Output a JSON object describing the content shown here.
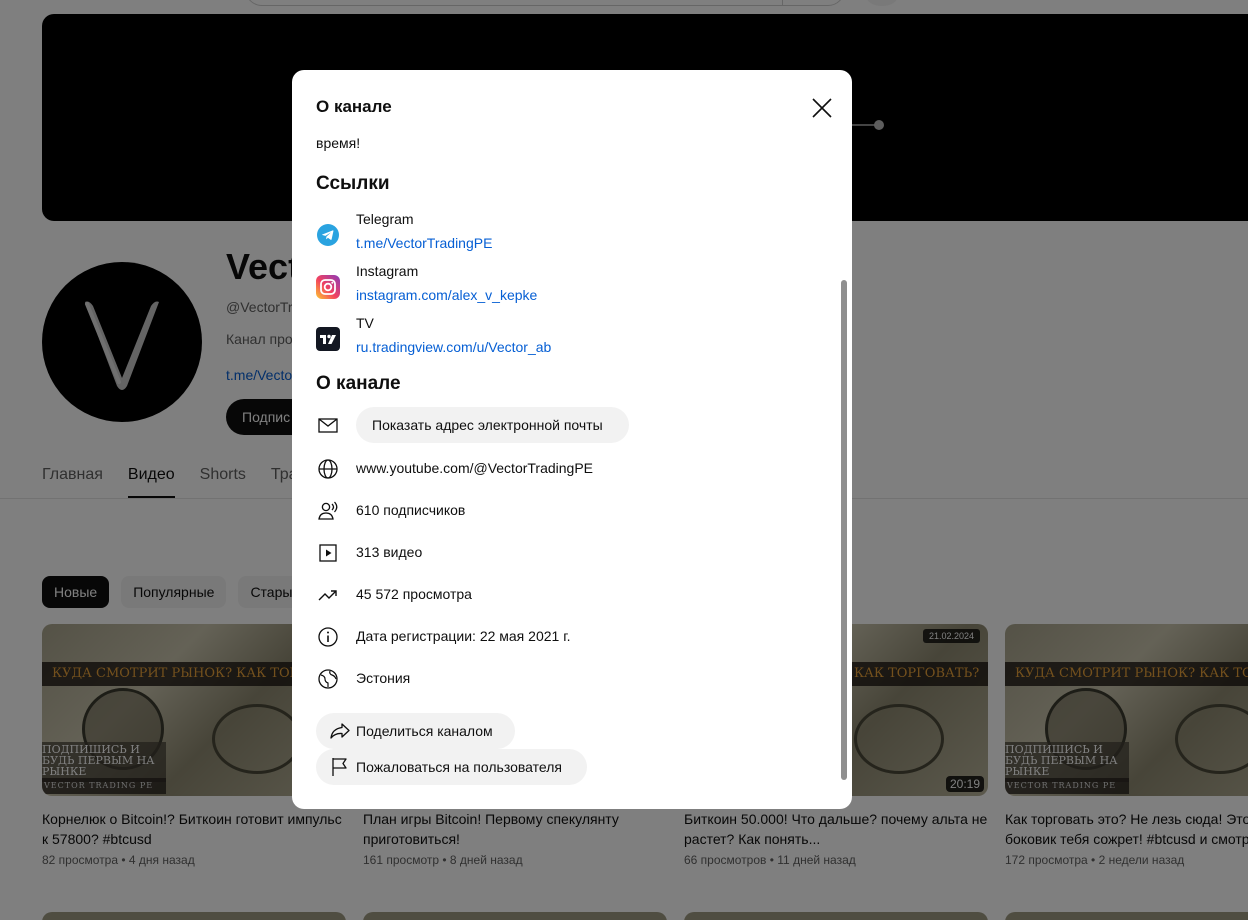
{
  "channel": {
    "name": "Vect",
    "handle": "@VectorTr",
    "description": "Канал про",
    "link": "t.me/Vecto",
    "subscribe_label": "Подпис"
  },
  "tabs": [
    {
      "label": "Главная",
      "active": false
    },
    {
      "label": "Видео",
      "active": true
    },
    {
      "label": "Shorts",
      "active": false
    },
    {
      "label": "Тра",
      "active": false
    }
  ],
  "chips": [
    {
      "label": "Новые",
      "active": true
    },
    {
      "label": "Популярные",
      "active": false
    },
    {
      "label": "Стары",
      "active": false
    }
  ],
  "videos": [
    {
      "title": "Корнелюк о Bitcoin!? Биткоин готовит импульс к 57800? #btcusd",
      "meta": "82 просмотра • 4 дня назад",
      "thumb_banner": "КУДА СМОТРИТ РЫНОК? КАК ТОРГОВАТЬ?",
      "thumb_cta": "ПОДПИШИСЬ И БУДЬ ПЕРВЫМ НА РЫНКЕ",
      "thumb_brand": "VECTOR TRADING PE",
      "duration": "",
      "date": ""
    },
    {
      "title": "План игры Bitcoin! Первому спекулянту приготовиться!",
      "meta": "161 просмотр • 8 дней назад",
      "thumb_banner": "",
      "thumb_cta": "",
      "thumb_brand": "",
      "duration": "",
      "date": ""
    },
    {
      "title": "Биткоин 50.000! Что дальше? почему альта не растет? Как понять...",
      "meta": "66 просмотров • 11 дней назад",
      "thumb_banner": "КАК ТОРГОВАТЬ?",
      "thumb_cta": "",
      "thumb_brand": "",
      "duration": "20:19",
      "date": "21.02.2024"
    },
    {
      "title": "Как торговать это? Не лезь сюда! Этот боковик тебя сожрет! #btcusd и смотр",
      "meta": "172 просмотра • 2 недели назад",
      "thumb_banner": "КУДА СМОТРИТ РЫНОК? КАК ТОРГОВАТЬ?",
      "thumb_cta": "ПОДПИШИСЬ И БУДЬ ПЕРВЫМ НА РЫНКЕ",
      "thumb_brand": "VECTOR TRADING PE",
      "duration": "",
      "date": ""
    }
  ],
  "modal": {
    "title": "О канале",
    "description_tail": "время!",
    "links_heading": "Ссылки",
    "links": [
      {
        "name": "Telegram",
        "url": "t.me/VectorTradingPE",
        "icon": "telegram-icon"
      },
      {
        "name": "Instagram",
        "url": "instagram.com/alex_v_kepke",
        "icon": "instagram-icon"
      },
      {
        "name": "TV",
        "url": "ru.tradingview.com/u/Vector_ab",
        "icon": "tradingview-icon"
      }
    ],
    "about_heading": "О канале",
    "email_button": "Показать адрес электронной почты",
    "url": "www.youtube.com/@VectorTradingPE",
    "subscribers": "610 подписчиков",
    "videos": "313 видео",
    "views": "45 572 просмотра",
    "joined": "Дата регистрации: 22 мая 2021 г.",
    "country": "Эстония",
    "share_button": "Поделиться каналом",
    "report_button": "Пожаловаться на пользователя"
  },
  "colors": {
    "accent_link": "#065fd4",
    "thumb_banner_text": "#e7a13a",
    "telegram": "#2aa3e0"
  }
}
